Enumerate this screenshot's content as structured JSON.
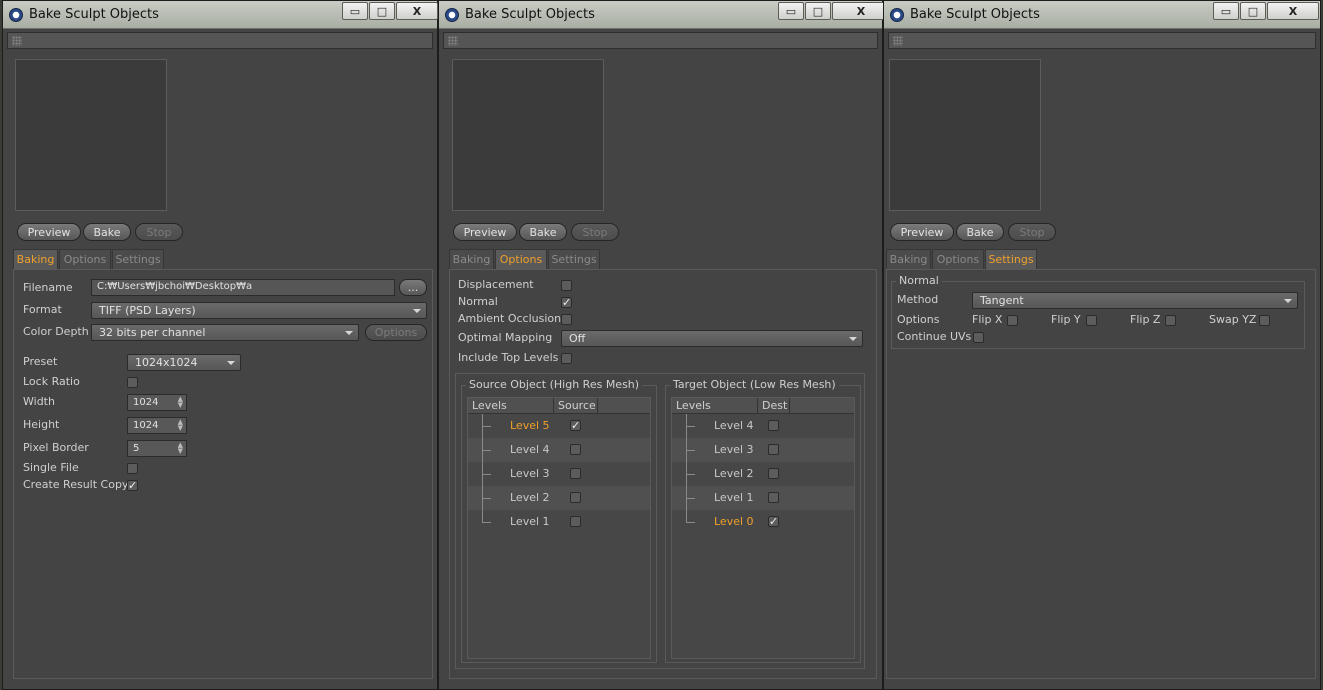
{
  "window_title": "Bake Sculpt Objects",
  "window_buttons": {
    "minimize": "▭",
    "maximize": "□",
    "close": "X"
  },
  "buttons": {
    "preview": "Preview",
    "bake": "Bake",
    "stop": "Stop"
  },
  "tabs": {
    "baking": "Baking",
    "options": "Options",
    "settings": "Settings"
  },
  "baking": {
    "filename_label": "Filename",
    "filename_value": "C:₩Users₩jbchoi₩Desktop₩a",
    "browse_label": "...",
    "format_label": "Format",
    "format_value": "TIFF (PSD Layers)",
    "color_depth_label": "Color Depth",
    "color_depth_value": "32 bits per channel",
    "options_button": "Options",
    "preset_label": "Preset",
    "preset_value": "1024x1024",
    "lock_ratio_label": "Lock Ratio",
    "width_label": "Width",
    "width_value": "1024",
    "height_label": "Height",
    "height_value": "1024",
    "pixel_border_label": "Pixel Border",
    "pixel_border_value": "5",
    "single_file_label": "Single File",
    "create_result_copy_label": "Create Result Copy",
    "create_result_copy_checked": true
  },
  "options": {
    "displacement_label": "Displacement",
    "normal_label": "Normal",
    "normal_checked": true,
    "ambient_occlusion_label": "Ambient Occlusion",
    "optimal_mapping_label": "Optimal Mapping",
    "optimal_mapping_value": "Off",
    "include_top_levels_label": "Include Top Levels",
    "source_group_title": "Source Object (High Res Mesh)",
    "target_group_title": "Target Object (Low Res Mesh)",
    "source_columns": [
      "Levels",
      "Source"
    ],
    "target_columns": [
      "Levels",
      "Dest"
    ],
    "source_levels": [
      {
        "label": "Level 5",
        "checked": true,
        "selected": true
      },
      {
        "label": "Level 4",
        "checked": false,
        "selected": false
      },
      {
        "label": "Level 3",
        "checked": false,
        "selected": false
      },
      {
        "label": "Level 2",
        "checked": false,
        "selected": false
      },
      {
        "label": "Level 1",
        "checked": false,
        "selected": false
      }
    ],
    "target_levels": [
      {
        "label": "Level 4",
        "checked": false,
        "selected": false
      },
      {
        "label": "Level 3",
        "checked": false,
        "selected": false
      },
      {
        "label": "Level 2",
        "checked": false,
        "selected": false
      },
      {
        "label": "Level 1",
        "checked": false,
        "selected": false
      },
      {
        "label": "Level 0",
        "checked": true,
        "selected": true
      }
    ]
  },
  "settings": {
    "group_title": "Normal",
    "method_label": "Method",
    "method_value": "Tangent",
    "options_label": "Options",
    "flip_x_label": "Flip X",
    "flip_y_label": "Flip Y",
    "flip_z_label": "Flip Z",
    "swap_yz_label": "Swap YZ",
    "continue_uvs_label": "Continue UVs"
  },
  "colors": {
    "accent": "#f0a02a",
    "panel": "#444444"
  }
}
